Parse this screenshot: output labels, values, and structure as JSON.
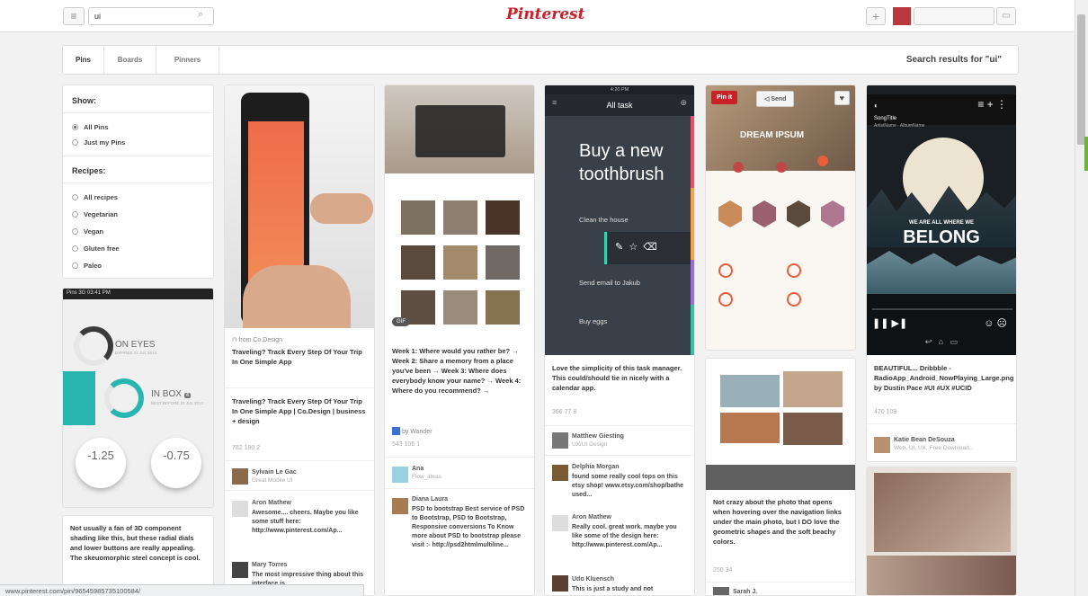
{
  "header": {
    "search_value": "ui",
    "logo": "Pinterest",
    "user": "",
    "add_icon": "plus-icon",
    "menu_icon": "hamburger-icon"
  },
  "tabs": {
    "pins": "Pins",
    "boards": "Boards",
    "pinners": "Pinners",
    "results": "Search results for \"ui\""
  },
  "filter": {
    "show_title": "Show:",
    "show_options": [
      "All Pins",
      "Just my Pins"
    ],
    "recipes_title": "Recipes:",
    "recipe_options": [
      "All recipes",
      "Vegetarian",
      "Vegan",
      "Gluten free",
      "Paleo"
    ]
  },
  "col1": {
    "phone_status": "Pins 3G  03:41 PM",
    "on_eyes": "ON EYES",
    "on_eyes_sub": "EXPIRES 21 JUL 2013",
    "in_box": "IN BOX",
    "in_box_count": "4",
    "in_box_sub": "BEST BEFORE 21 JUL 2013",
    "val_left": "-1.25",
    "val_right": "-0.75",
    "desc": "Not usually a fan of 3D component shading like this, but these radial dials and lower buttons are really appealing. The skeuomorphic steel concept is cool."
  },
  "col2": {
    "source": "from Co.Design",
    "title": "Traveling? Track Every Step Of Your Trip In One Simple App",
    "desc": "Traveling? Track Every Step Of Your Trip In One Simple App | Co.Design | business + design",
    "stats": "782   180   2",
    "user1": "Sylvain Le Gac",
    "user1_board": "Great Mobile UI",
    "c1_user": "Aron Mathew",
    "c1_text": "Awesome.... cheers. Maybe you like some stuff here: http://www.pinterest.com/Ap...",
    "c2_user": "Mary Torres",
    "c2_text": "The most impressive thing about this interface is"
  },
  "col3": {
    "desc": "Week 1: Where would you rather be? → Week 2: Share a memory from a place you've been → Week 3: Where does everybody know your name? → Week 4: Where do you recommend? →",
    "by": "by Wander",
    "stats": "543   106   1",
    "user": "Ana",
    "user_board": "Flow_ideas",
    "c1_user": "Diana Laura",
    "c1_text": "PSD to bootstrap Best service of PSD to Bootstrap, PSD to Bootstrap, Responsive conversions To Know more about PSD to bootstrap please visit :- http://psd2htmlmultiline...",
    "gif": "GIF"
  },
  "col4": {
    "app_title": "All task",
    "status": "4:20 PM",
    "big_task": "Buy a new toothbrush",
    "task1": "Clean the house",
    "task2": "Send email to Jakub",
    "task3": "Buy eggs",
    "desc": "Love the simplicity of this task manager. This could/should tie in nicely with a calendar app.",
    "stats": "366   77   8",
    "user": "Matthew Giesting",
    "user_board": "UX/UI Design",
    "c1_user": "Delphia Morgan",
    "c1_text": "found some really cool tops on this etsy shop! www.etsy.com/shop/bathe used...",
    "c2_user": "Aron Mathew",
    "c2_text": "Really cool. great work. maybe you like some of the design here: http://www.pinterest.com/Ap...",
    "c3_user": "Udo Kluensch",
    "c3_text": "This is just a study and not"
  },
  "col5": {
    "pinit": "Pin it",
    "send": "Send",
    "hero": "DREAM IPSUM",
    "desc": "Not crazy about the photo that opens when hovering over the navigation links under the main photo, but I DO love the geometric shapes and the soft beachy colors.",
    "stats": "250   34",
    "user": "Sarah J."
  },
  "col6": {
    "song": "SongTitle",
    "artist": "ArtistName · AlbumName",
    "line1": "WE ARE ALL WHERE WE",
    "line2": "BELONG",
    "desc": "BEAUTIFUL... Dribbble - RadioApp_Android_NowPlaying_Large.png by Dustin Pace #UI #UX #UCID",
    "stats": "470   109",
    "user": "Katie Bean DeSouza",
    "user_board": "Web, UI, UX, Free Download..."
  },
  "statusbar": "www.pinterest.com/pin/96545985735100584/"
}
